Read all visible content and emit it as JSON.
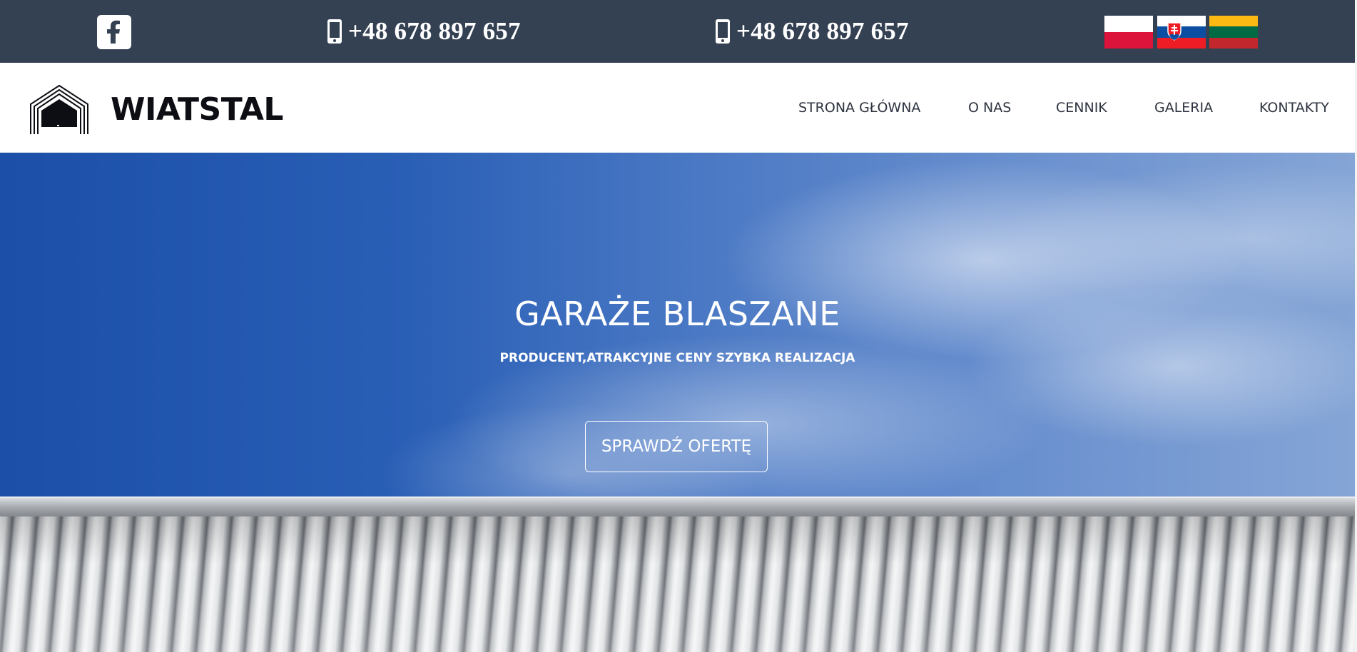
{
  "topbar": {
    "facebook_icon": "facebook-icon",
    "phone_icon": "mobile-phone-icon",
    "phones": [
      "+48 678 897 657",
      "+48 678 897 657"
    ],
    "flags": [
      {
        "name": "poland-flag",
        "colors": [
          "#ffffff",
          "#dc143c"
        ]
      },
      {
        "name": "slovakia-flag",
        "colors": [
          "#ffffff",
          "#0b4ea2",
          "#ee1c25"
        ]
      },
      {
        "name": "lithuania-flag",
        "colors": [
          "#fdb913",
          "#006a44",
          "#c1272d"
        ]
      }
    ],
    "background": "#344152"
  },
  "header": {
    "logo_text": "WIATSTAL",
    "nav": [
      "STRONA GŁÓWNA",
      "O NAS",
      "CENNIK",
      "GALERIA",
      "KONTAKTY"
    ]
  },
  "hero": {
    "title": "GARAŻE BLASZANE",
    "subtitle": "PRODUCENT,ATRAKCYJNE CENY SZYBKA REALIZACJA",
    "cta_label": "SPRAWDŹ OFERTĘ"
  }
}
